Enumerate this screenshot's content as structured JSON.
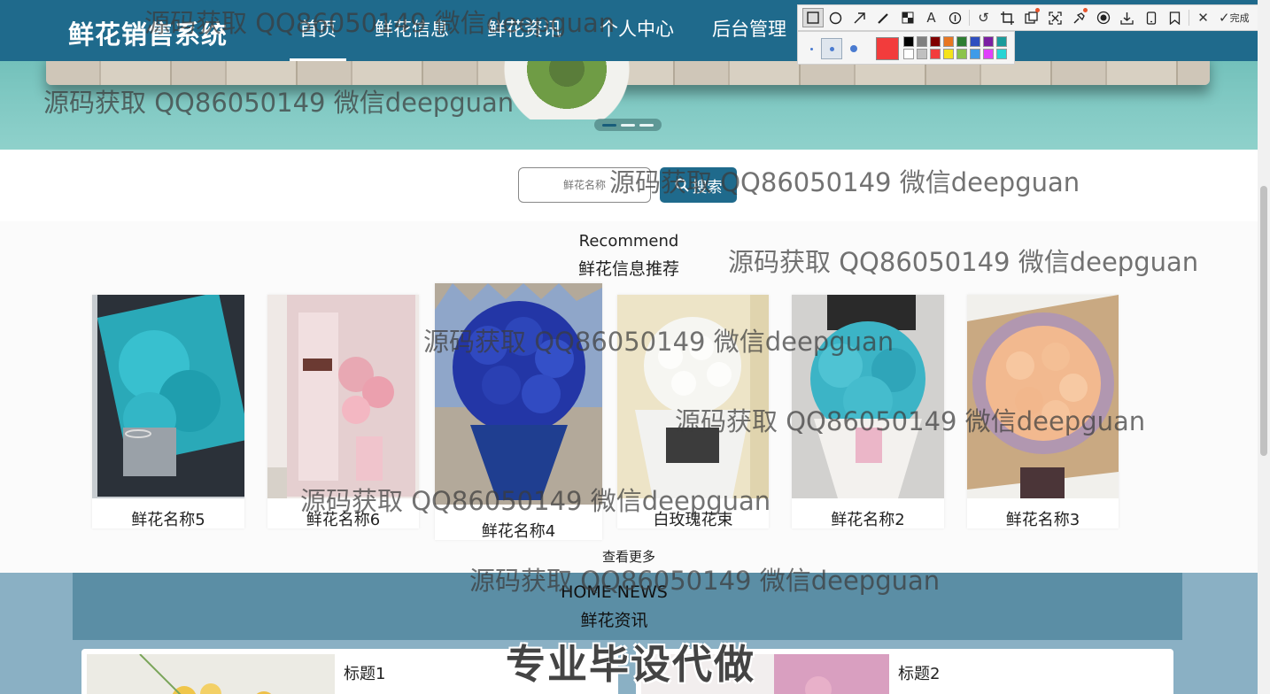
{
  "nav": {
    "brand": "鲜花销售系统",
    "items": [
      {
        "label": "首页",
        "active": true
      },
      {
        "label": "鲜花信息",
        "active": false
      },
      {
        "label": "鲜花资讯",
        "active": false
      },
      {
        "label": "个人中心",
        "active": false
      },
      {
        "label": "后台管理",
        "active": false
      }
    ]
  },
  "screenshot_tool": {
    "icons": [
      "rectangle-icon",
      "circle-icon",
      "arrow-icon",
      "pen-icon",
      "mosaic-icon",
      "text-icon",
      "number-marker-icon",
      "undo-icon",
      "crop-icon",
      "ocr-icon",
      "scan-icon",
      "pin-icon",
      "record-icon",
      "download-icon",
      "phone-icon",
      "bookmark-icon",
      "close-icon",
      "check-icon"
    ],
    "done_label": "完成",
    "current_color": "#f23c3c",
    "swatches": [
      "#000000",
      "#808080",
      "#800000",
      "#e87722",
      "#2e7d32",
      "#2f4fbf",
      "#7b1fa2",
      "#1a9b9b",
      "#ffffff",
      "#c0c0c0",
      "#f23c3c",
      "#f5e31a",
      "#8bc34a",
      "#3f9be8",
      "#e040fb",
      "#26d4d4"
    ]
  },
  "hero": {
    "slides": 3,
    "active_slide": 1
  },
  "search": {
    "placeholder": "鲜花名称",
    "button_label": "搜索"
  },
  "recommend": {
    "title_en": "Recommend",
    "title_cn": "鲜花信息推荐",
    "items": [
      {
        "name": "鲜花名称5",
        "image": "blue-baby-breath-box"
      },
      {
        "name": "鲜花名称6",
        "image": "pink-rose-gift-box"
      },
      {
        "name": "鲜花名称4",
        "image": "blue-rose-bouquet"
      },
      {
        "name": "白玫瑰花束",
        "image": "white-rose-bouquet"
      },
      {
        "name": "鲜花名称2",
        "image": "blue-baby-breath-bouquet"
      },
      {
        "name": "鲜花名称3",
        "image": "peach-rose-bouquet"
      }
    ],
    "more_label": "查看更多"
  },
  "news": {
    "title_en": "HOME NEWS",
    "title_cn": "鲜花资讯",
    "items": [
      {
        "title": "标题1"
      },
      {
        "title": "标题2"
      }
    ]
  },
  "overlay": {
    "banner": "专业毕设代做",
    "watermark": "源码获取 QQ86050149 微信deepguan"
  }
}
